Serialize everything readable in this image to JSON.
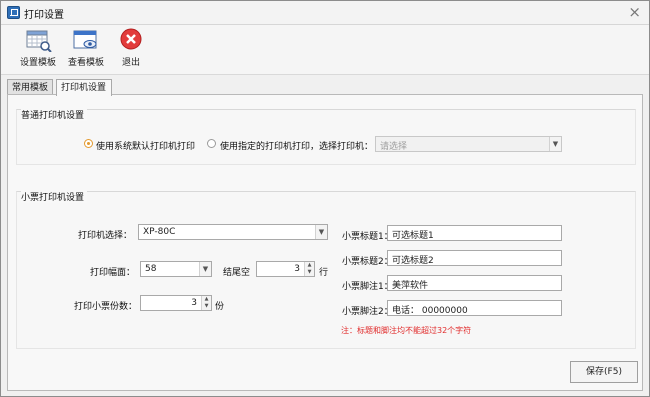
{
  "window": {
    "title": "打印设置",
    "close_icon": "close-icon"
  },
  "toolbar": {
    "items": [
      {
        "label": "设置模板",
        "icon": "template-settings-icon"
      },
      {
        "label": "查看模板",
        "icon": "view-template-icon"
      },
      {
        "label": "退出",
        "icon": "exit-icon"
      }
    ]
  },
  "tabs": [
    {
      "label": "常用模板",
      "active": false
    },
    {
      "label": "打印机设置",
      "active": true
    }
  ],
  "normal_printer": {
    "title": "普通打印机设置",
    "option_default": "使用系统默认打印机打印",
    "option_specified": "使用指定的打印机打印，选择打印机：",
    "printer_select_placeholder": "请选择"
  },
  "receipt_printer": {
    "title": "小票打印机设置",
    "printer_label": "打印机选择：",
    "printer_value": "XP-80C",
    "width_label": "打印幅面：",
    "width_value": "58",
    "tail_label": "结尾空",
    "tail_value": "3",
    "tail_unit": "行",
    "copies_label": "打印小票份数：",
    "copies_value": "3",
    "copies_unit": "份",
    "title1_label": "小票标题1：",
    "title1_value": "可选标题1",
    "title2_label": "小票标题2：",
    "title2_value": "可选标题2",
    "footer1_label": "小票脚注1：",
    "footer1_value": "美萍软件",
    "footer2_label": "小票脚注2：",
    "footer2_value": "电话： 00000000",
    "note": "注：标题和脚注均不能超过32个字符"
  },
  "buttons": {
    "save": "保存(F5)"
  },
  "colors": {
    "accent": "#e39a2f",
    "warning": "#e12b2b"
  }
}
